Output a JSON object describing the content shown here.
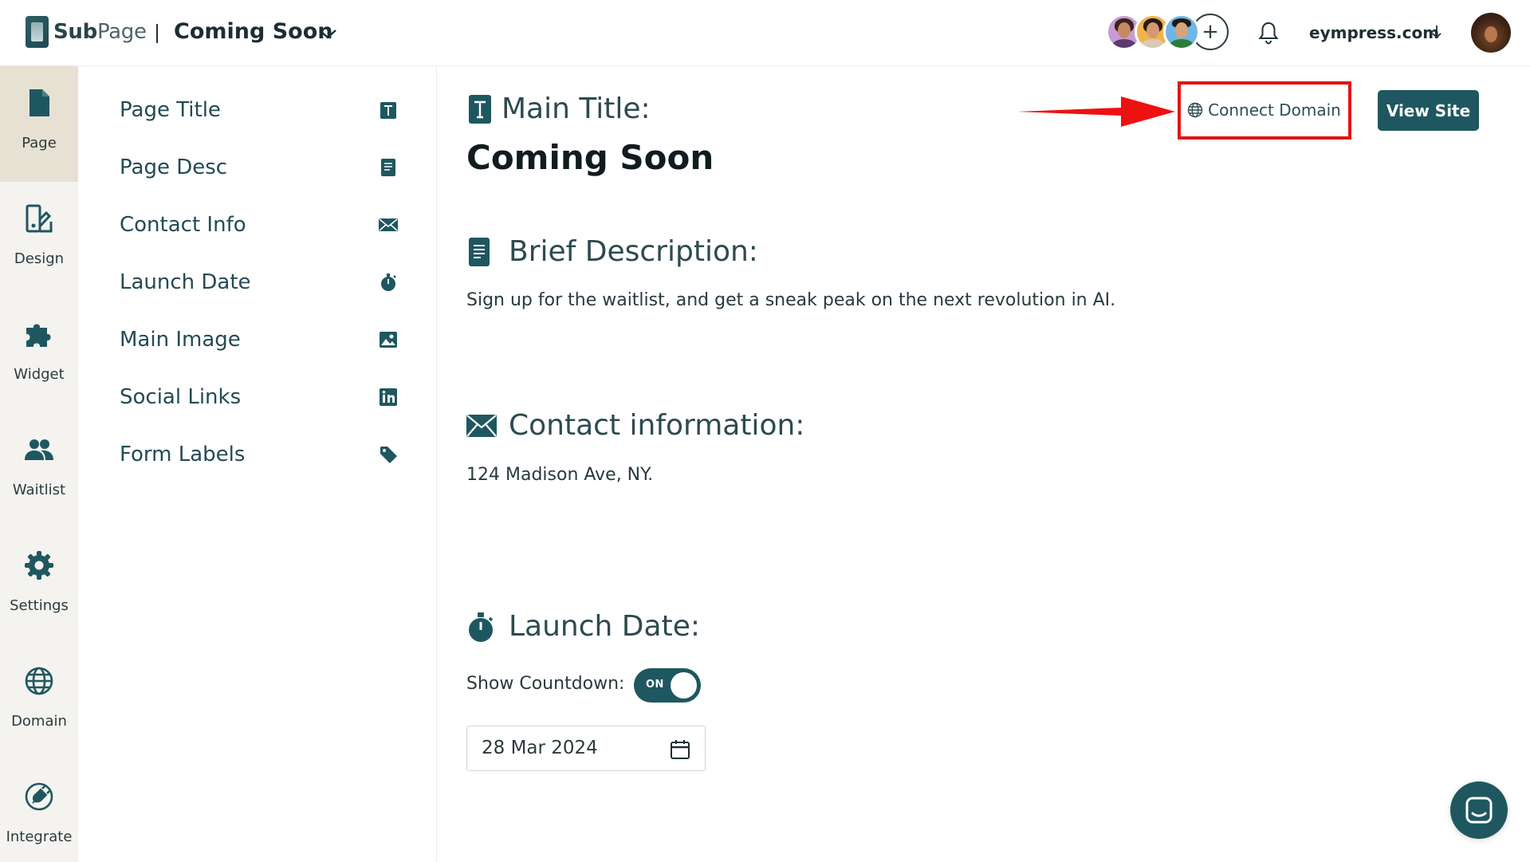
{
  "header": {
    "logo_bold": "Sub",
    "logo_light": "Page",
    "project_name": "Coming Soon",
    "account": "eympress.com",
    "add_member": "+"
  },
  "rail": {
    "items": [
      {
        "label": "Page",
        "icon": "page-icon"
      },
      {
        "label": "Design",
        "icon": "design-icon"
      },
      {
        "label": "Widget",
        "icon": "puzzle-icon"
      },
      {
        "label": "Waitlist",
        "icon": "users-icon"
      },
      {
        "label": "Settings",
        "icon": "gear-icon"
      },
      {
        "label": "Domain",
        "icon": "globe-icon"
      },
      {
        "label": "Integrate",
        "icon": "plug-icon"
      }
    ]
  },
  "sections": {
    "items": [
      {
        "label": "Page Title",
        "icon": "text-t-icon"
      },
      {
        "label": "Page Desc",
        "icon": "document-icon"
      },
      {
        "label": "Contact Info",
        "icon": "envelope-icon"
      },
      {
        "label": "Launch Date",
        "icon": "stopwatch-icon"
      },
      {
        "label": "Main Image",
        "icon": "image-icon"
      },
      {
        "label": "Social Links",
        "icon": "linkedin-icon"
      },
      {
        "label": "Form Labels",
        "icon": "tag-icon"
      }
    ]
  },
  "main": {
    "title_heading": "Main Title:",
    "title_value": "Coming Soon",
    "desc_heading": "Brief Description:",
    "desc_value": "Sign up for the waitlist, and get a sneak peak on the next revolution in AI.",
    "contact_heading": "Contact information:",
    "contact_value": "124 Madison Ave, NY.",
    "launch_heading": "Launch Date:",
    "countdown_label": "Show Countdown:",
    "countdown_state": "ON",
    "launch_date": "28 Mar 2024",
    "connect_domain": "Connect Domain",
    "view_site": "View Site"
  },
  "colors": {
    "brand": "#1f5760",
    "highlight": "#e01616",
    "rail_active": "#e7e1d3"
  }
}
